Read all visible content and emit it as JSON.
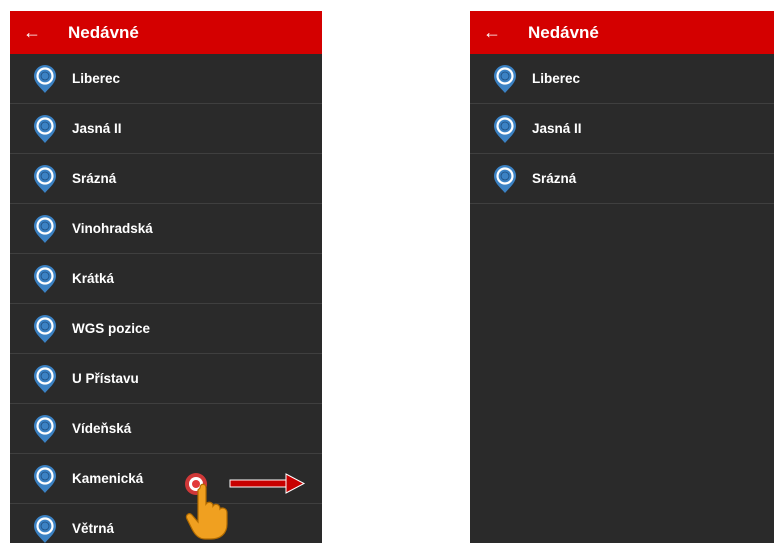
{
  "colors": {
    "appbar": "#d40000",
    "background": "#2a2a2a",
    "pin_fill": "#3b82c4",
    "pin_ring": "#ffffff"
  },
  "left_screen": {
    "back_icon": "arrow-left-icon",
    "title": "Nedávné",
    "items": [
      {
        "label": "Liberec",
        "icon": "location-pin-icon"
      },
      {
        "label": "Jasná II",
        "icon": "location-pin-icon"
      },
      {
        "label": "Srázná",
        "icon": "location-pin-icon"
      },
      {
        "label": "Vinohradská",
        "icon": "location-pin-icon"
      },
      {
        "label": "Krátká",
        "icon": "location-pin-icon"
      },
      {
        "label": "WGS pozice",
        "icon": "location-pin-icon"
      },
      {
        "label": "U Přístavu",
        "icon": "location-pin-icon"
      },
      {
        "label": "Vídeňská",
        "icon": "location-pin-icon"
      },
      {
        "label": "Kamenická",
        "icon": "location-pin-icon"
      },
      {
        "label": "Větrná",
        "icon": "location-pin-icon"
      }
    ],
    "gesture_hint": {
      "icon": "swipe-hand-icon",
      "direction": "right"
    }
  },
  "right_screen": {
    "back_icon": "arrow-left-icon",
    "title": "Nedávné",
    "items": [
      {
        "label": "Liberec",
        "icon": "location-pin-icon"
      },
      {
        "label": "Jasná II",
        "icon": "location-pin-icon"
      },
      {
        "label": "Srázná",
        "icon": "location-pin-icon"
      }
    ]
  }
}
